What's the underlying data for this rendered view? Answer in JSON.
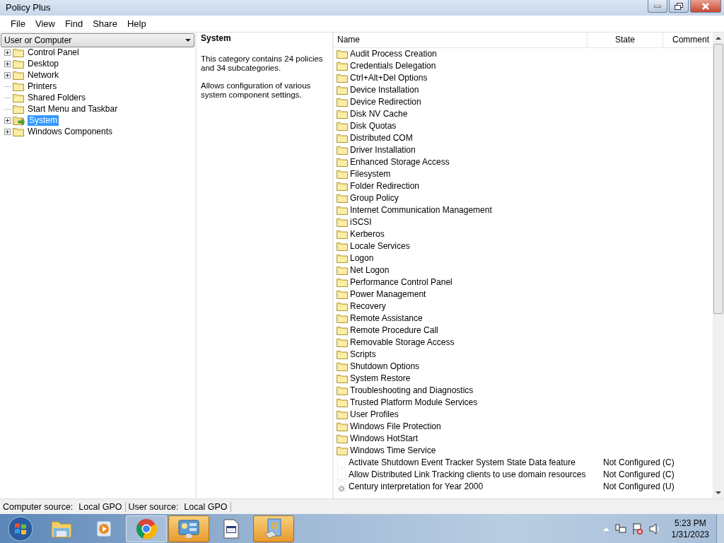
{
  "window": {
    "title": "Policy Plus"
  },
  "menu": [
    "File",
    "View",
    "Find",
    "Share",
    "Help"
  ],
  "scope_dropdown": {
    "value": "User or Computer"
  },
  "tree": [
    {
      "label": "Control Panel",
      "expandable": true,
      "selected": false
    },
    {
      "label": "Desktop",
      "expandable": true,
      "selected": false
    },
    {
      "label": "Network",
      "expandable": true,
      "selected": false
    },
    {
      "label": "Printers",
      "expandable": false,
      "selected": false
    },
    {
      "label": "Shared Folders",
      "expandable": false,
      "selected": false
    },
    {
      "label": "Start Menu and Taskbar",
      "expandable": false,
      "selected": false
    },
    {
      "label": "System",
      "expandable": true,
      "selected": true
    },
    {
      "label": "Windows Components",
      "expandable": true,
      "selected": false
    }
  ],
  "details": {
    "title": "System",
    "summary": "This category contains 24 policies and 34 subcategories.",
    "description": "Allows configuration of various system component settings."
  },
  "table": {
    "columns": [
      "Name",
      "State",
      "Comment"
    ],
    "rows": [
      {
        "kind": "folder",
        "name": "Audit Process Creation"
      },
      {
        "kind": "folder",
        "name": "Credentials Delegation"
      },
      {
        "kind": "folder",
        "name": "Ctrl+Alt+Del Options"
      },
      {
        "kind": "folder",
        "name": "Device Installation"
      },
      {
        "kind": "folder",
        "name": "Device Redirection"
      },
      {
        "kind": "folder",
        "name": "Disk NV Cache"
      },
      {
        "kind": "folder",
        "name": "Disk Quotas"
      },
      {
        "kind": "folder",
        "name": "Distributed COM"
      },
      {
        "kind": "folder",
        "name": "Driver Installation"
      },
      {
        "kind": "folder",
        "name": "Enhanced Storage Access"
      },
      {
        "kind": "folder",
        "name": "Filesystem"
      },
      {
        "kind": "folder",
        "name": "Folder Redirection"
      },
      {
        "kind": "folder",
        "name": "Group Policy"
      },
      {
        "kind": "folder",
        "name": "Internet Communication Management"
      },
      {
        "kind": "folder",
        "name": "iSCSI"
      },
      {
        "kind": "folder",
        "name": "Kerberos"
      },
      {
        "kind": "folder",
        "name": "Locale Services"
      },
      {
        "kind": "folder",
        "name": "Logon"
      },
      {
        "kind": "folder",
        "name": "Net Logon"
      },
      {
        "kind": "folder",
        "name": "Performance Control Panel"
      },
      {
        "kind": "folder",
        "name": "Power Management"
      },
      {
        "kind": "folder",
        "name": "Recovery"
      },
      {
        "kind": "folder",
        "name": "Remote Assistance"
      },
      {
        "kind": "folder",
        "name": "Remote Procedure Call"
      },
      {
        "kind": "folder",
        "name": "Removable Storage Access"
      },
      {
        "kind": "folder",
        "name": "Scripts"
      },
      {
        "kind": "folder",
        "name": "Shutdown Options"
      },
      {
        "kind": "folder",
        "name": "System Restore"
      },
      {
        "kind": "folder",
        "name": "Troubleshooting and Diagnostics"
      },
      {
        "kind": "folder",
        "name": "Trusted Platform Module Services"
      },
      {
        "kind": "folder",
        "name": "User Profiles"
      },
      {
        "kind": "folder",
        "name": "Windows File Protection"
      },
      {
        "kind": "folder",
        "name": "Windows HotStart"
      },
      {
        "kind": "folder",
        "name": "Windows Time Service"
      },
      {
        "kind": "policy",
        "name": "Activate Shutdown Event Tracker System State Data feature",
        "state": "Not Configured (C)"
      },
      {
        "kind": "policy",
        "name": "Allow Distributed Link Tracking clients to use domain resources",
        "state": "Not Configured (C)"
      },
      {
        "kind": "setting",
        "name": "Century interpretation for Year 2000",
        "state": "Not Configured (U)"
      }
    ]
  },
  "status_bar": [
    {
      "label": "Computer source:",
      "value": "Local GPO"
    },
    {
      "label": "User source:",
      "value": "Local GPO"
    }
  ],
  "taskbar": {
    "apps": [
      {
        "kind": "explorer",
        "selected": false
      },
      {
        "kind": "media",
        "selected": false
      },
      {
        "kind": "browser",
        "selected": false
      },
      {
        "kind": "panel",
        "selected": true
      },
      {
        "kind": "document",
        "selected": false
      },
      {
        "kind": "installer",
        "selected": true
      }
    ],
    "time": "5:23 PM",
    "date": "1/31/2023"
  }
}
